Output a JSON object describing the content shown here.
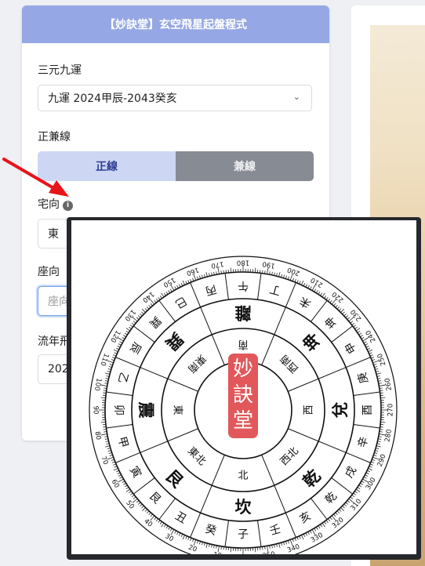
{
  "header": {
    "title": "【妙訣堂】玄空飛星起盤程式"
  },
  "form": {
    "era_label": "三元九運",
    "era_value": "九運 2024甲辰-2043癸亥",
    "line_label": "正兼線",
    "line_options": [
      "正線",
      "兼線"
    ],
    "line_selected": "正線",
    "facing_label": "宅向",
    "facing_value": "東",
    "sitting_label": "座向",
    "sitting_placeholder": "座向",
    "year_label": "流年飛",
    "year_value": "202"
  },
  "icons": {
    "info": "info-icon",
    "chevron": "chevron-down-icon",
    "arrow": "red-arrow-annotation"
  },
  "compass": {
    "seal_text": [
      "妙",
      "訣",
      "堂"
    ],
    "degree_labels": [
      "0",
      "10",
      "20",
      "30",
      "40",
      "50",
      "60",
      "70",
      "80",
      "90",
      "100",
      "110",
      "120",
      "130",
      "140",
      "150",
      "160",
      "170",
      "180",
      "190",
      "200",
      "210",
      "220",
      "230",
      "240",
      "250",
      "260",
      "270",
      "280",
      "290",
      "300",
      "310",
      "320",
      "330",
      "340",
      "350"
    ],
    "mountains": [
      {
        "name": "子",
        "deg": 0
      },
      {
        "name": "癸",
        "deg": 15
      },
      {
        "name": "丑",
        "deg": 30
      },
      {
        "name": "艮",
        "deg": 45
      },
      {
        "name": "寅",
        "deg": 60
      },
      {
        "name": "甲",
        "deg": 75
      },
      {
        "name": "卯",
        "deg": 90
      },
      {
        "name": "乙",
        "deg": 105
      },
      {
        "name": "辰",
        "deg": 120
      },
      {
        "name": "巽",
        "deg": 135
      },
      {
        "name": "巳",
        "deg": 150
      },
      {
        "name": "丙",
        "deg": 165
      },
      {
        "name": "午",
        "deg": 180
      },
      {
        "name": "丁",
        "deg": 195
      },
      {
        "name": "未",
        "deg": 210
      },
      {
        "name": "坤",
        "deg": 225
      },
      {
        "name": "申",
        "deg": 240
      },
      {
        "name": "庚",
        "deg": 255
      },
      {
        "name": "酉",
        "deg": 270
      },
      {
        "name": "辛",
        "deg": 285
      },
      {
        "name": "戌",
        "deg": 300
      },
      {
        "name": "乾",
        "deg": 315
      },
      {
        "name": "亥",
        "deg": 330
      },
      {
        "name": "壬",
        "deg": 345
      }
    ],
    "trigrams": [
      {
        "name": "坎",
        "deg": 0
      },
      {
        "name": "艮",
        "deg": 45
      },
      {
        "name": "震",
        "deg": 90
      },
      {
        "name": "巽",
        "deg": 135
      },
      {
        "name": "離",
        "deg": 180
      },
      {
        "name": "坤",
        "deg": 225
      },
      {
        "name": "兌",
        "deg": 270
      },
      {
        "name": "乾",
        "deg": 315
      }
    ],
    "directions": [
      {
        "name": "北",
        "deg": 0
      },
      {
        "name": "東北",
        "deg": 45
      },
      {
        "name": "東",
        "deg": 90
      },
      {
        "name": "東南",
        "deg": 135
      },
      {
        "name": "南",
        "deg": 180
      },
      {
        "name": "西南",
        "deg": 225
      },
      {
        "name": "西",
        "deg": 270
      },
      {
        "name": "西北",
        "deg": 315
      }
    ]
  },
  "colors": {
    "header_bg": "#95a7e4",
    "toggle_on": "#cdd7f3",
    "toggle_off": "#878b94",
    "seal": "#e2575a",
    "arrow": "#e8141b"
  }
}
